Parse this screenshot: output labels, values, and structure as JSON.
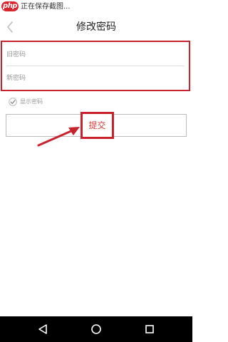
{
  "status_bar": {
    "logo_text": "php",
    "text": "正在保存截图..."
  },
  "header": {
    "title": "修改密码",
    "back_icon": "chevron-left-icon"
  },
  "form": {
    "old_password_placeholder": "旧密码",
    "new_password_placeholder": "新密码",
    "show_password_label": "显示密码",
    "show_password_checked": true,
    "submit_label": "提交"
  },
  "annotations": {
    "highlight_color": "#c8232c"
  },
  "nav_bar": {
    "back_icon": "triangle-back-icon",
    "home_icon": "circle-home-icon",
    "recent_icon": "square-recent-icon"
  },
  "colors": {
    "accent": "#c8232c",
    "nav_background": "#000000"
  }
}
